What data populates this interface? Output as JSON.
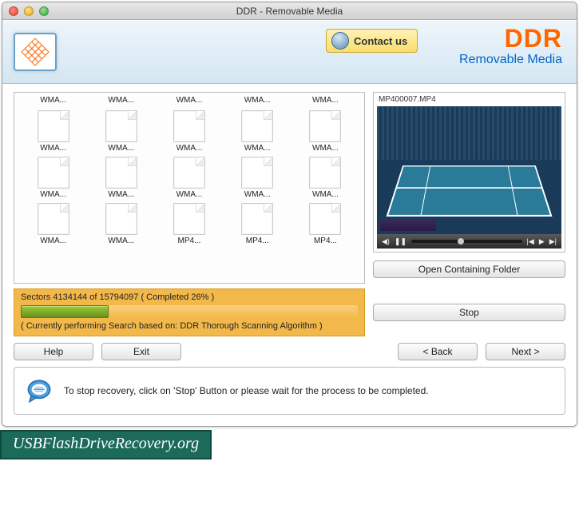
{
  "window": {
    "title": "DDR - Removable Media"
  },
  "banner": {
    "contact_label": "Contact us",
    "brand_title": "DDR",
    "brand_subtitle": "Removable Media"
  },
  "files": {
    "partial_row": [
      "WMA...",
      "WMA...",
      "WMA...",
      "WMA...",
      "WMA..."
    ],
    "grid": [
      "WMA...",
      "WMA...",
      "WMA...",
      "WMA...",
      "WMA...",
      "WMA...",
      "WMA...",
      "WMA...",
      "WMA...",
      "WMA...",
      "WMA...",
      "WMA...",
      "MP4...",
      "MP4...",
      "MP4..."
    ]
  },
  "preview": {
    "filename": "MP400007.MP4",
    "open_folder_label": "Open Containing Folder"
  },
  "progress": {
    "sectors_text": "Sectors 4134144 of 15794097    ( Completed 26% )",
    "algorithm_text": "( Currently performing Search based on: DDR Thorough Scanning Algorithm )",
    "percent": 26,
    "stop_label": "Stop"
  },
  "buttons": {
    "help": "Help",
    "exit": "Exit",
    "back": "< Back",
    "next": "Next >"
  },
  "info": {
    "message": "To stop recovery, click on 'Stop' Button or please wait for the process to be completed."
  },
  "footer": {
    "site": "USBFlashDriveRecovery.org"
  }
}
